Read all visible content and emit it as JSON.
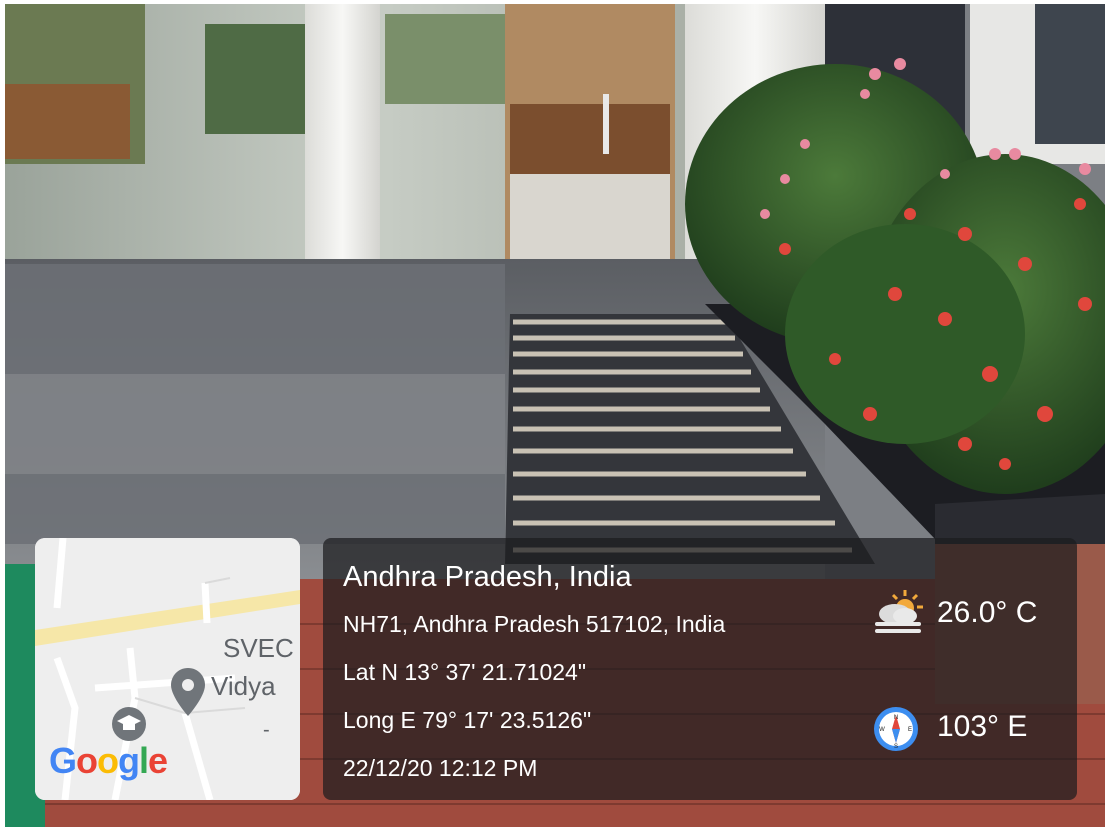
{
  "overlay": {
    "title": "Andhra Pradesh, India",
    "address": "NH71, Andhra Pradesh 517102, India",
    "latitude": "Lat N 13° 37' 21.71024\"",
    "longitude": "Long E 79° 17' 23.5126\"",
    "datetime": "22/12/20 12:12 PM",
    "temperature": "26.0° C",
    "heading": "103° E",
    "weather_icon": "partly-cloudy-icon",
    "compass_icon": "compass-icon"
  },
  "map": {
    "label_line1": "SVEC",
    "label_line2": "Vidya",
    "label_line3": "-",
    "logo_text": "Google",
    "marker_icon": "map-pin-icon",
    "poi_icon": "graduation-cap-icon"
  },
  "colors": {
    "panel": "#1c1c1e",
    "text": "#ffffff",
    "map_road": "#f6e7a8",
    "map_bg": "#eeeeee",
    "pin": "#70757a"
  }
}
